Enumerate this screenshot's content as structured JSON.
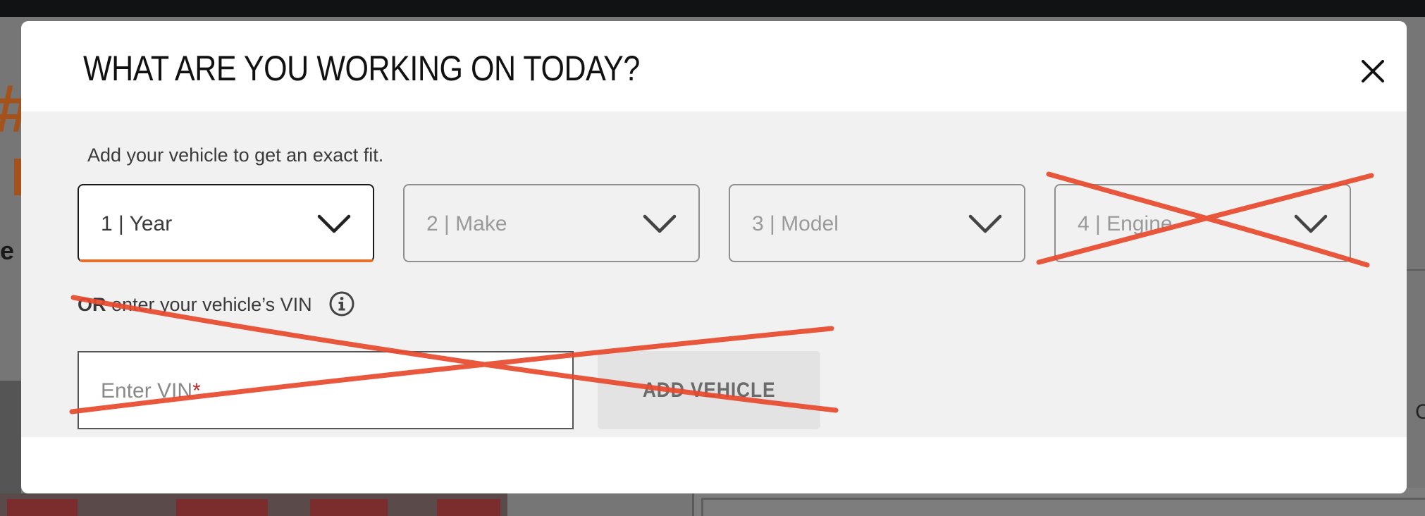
{
  "background": {
    "left_glyph": "#",
    "left_text": "e",
    "right_text": "C"
  },
  "modal": {
    "title": "WHAT ARE YOU WORKING ON TODAY?",
    "close_icon": "close-icon",
    "instructions": "Add your vehicle to get an exact fit.",
    "selects": [
      {
        "label": "1 | Year",
        "active": true
      },
      {
        "label": "2 | Make",
        "active": false
      },
      {
        "label": "3 | Model",
        "active": false
      },
      {
        "label": "4 | Engine",
        "active": false
      }
    ],
    "vin": {
      "or_prefix": "OR",
      "or_text": " enter your vehicle’s VIN",
      "info_icon": "info-icon",
      "placeholder": "Enter VIN",
      "required_mark": "*",
      "button_label": "ADD VEHICLE"
    }
  },
  "colors": {
    "accent": "#e66f2a",
    "annotation_red": "#e8492d",
    "required": "#c22a2a"
  }
}
